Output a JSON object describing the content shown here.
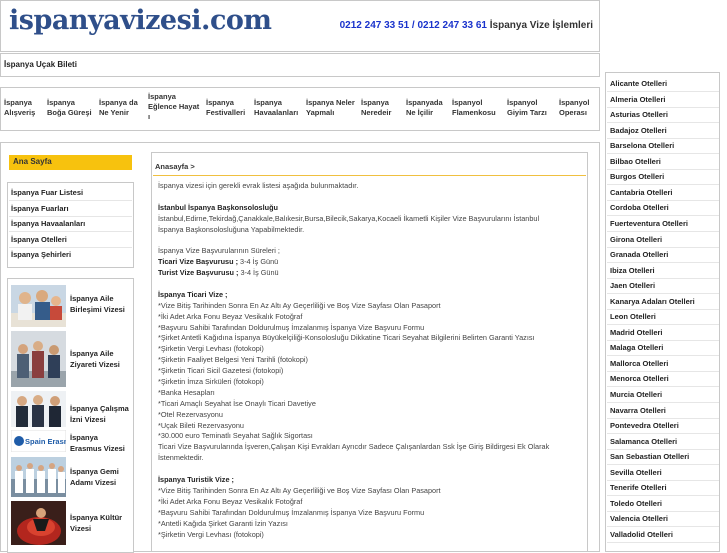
{
  "header": {
    "logo_text": "ispanyavizesi.com",
    "phone1": "0212 247 33 51",
    "phone_sep": " / ",
    "phone2": "0212 247 33 61",
    "tagline": " İspanya Vize İşlemleri"
  },
  "topbar": {
    "link": "İspanya Uçak Bileti"
  },
  "nav": [
    [
      "İspanya",
      "Alışveriş"
    ],
    [
      "İspanya",
      "Boğa Güreşi"
    ],
    [
      "İspanya da",
      "Ne Yenir"
    ],
    [
      "İspanya",
      "Eğlence Hayat",
      "ı"
    ],
    [
      "İspanya",
      "Festivalleri"
    ],
    [
      "İspanya",
      "Havaalanları"
    ],
    [
      "İspanya Neler",
      "Yapmalı"
    ],
    [
      "İspanya",
      "Neredeir"
    ],
    [
      "İspanyada",
      "Ne İçilir"
    ],
    [
      "İspanyol",
      "Flamenkosu"
    ],
    [
      "İspanyol",
      "Giyim Tarzı"
    ],
    [
      "İspanyol",
      "Operası"
    ]
  ],
  "cities": [
    "Alicante Otelleri",
    "Almeria Otelleri",
    "Asturias Otelleri",
    "Badajoz Otelleri",
    "Barselona Otelleri",
    "Bilbao Otelleri",
    "Burgos Otelleri",
    "Cantabria Otelleri",
    "Cordoba Otelleri",
    "Fuerteventura Otelleri",
    "Girona Otelleri",
    "Granada Otelleri",
    "Ibiza Otelleri",
    "Jaen Otelleri",
    "Kanarya Adaları Otelleri",
    "Leon Otelleri",
    "Madrid Otelleri",
    "Malaga Otelleri",
    "Mallorca Otelleri",
    "Menorca Otelleri",
    "Murcia Otelleri",
    "Navarra Otelleri",
    "Pontevedra Otelleri",
    "Salamanca Otelleri",
    "San Sebastian Otelleri",
    "Sevilla Otelleri",
    "Tenerife Otelleri",
    "Toledo Otelleri",
    "Valencia Otelleri",
    "Valladolid Otelleri"
  ],
  "sidebar": {
    "home_label": "Ana Sayfa",
    "menu": [
      "İspanya Fuar Listesi",
      "İspanya Fuarları",
      "İspanya Havaalanları",
      "İspanya Otelleri",
      "İspanya Şehirleri"
    ],
    "visas": [
      {
        "l1": "İspanya Aile",
        "l2": "Birleşimi Vizesi"
      },
      {
        "l1": "İspanya Aile",
        "l2": "Ziyareti Vizesi"
      },
      {
        "l1": "İspanya Çalışma",
        "l2": "İzni Vizesi"
      },
      {
        "l1": "İspanya",
        "l2": "Erasmus Vizesi"
      },
      {
        "l1": "İspanya Gemi",
        "l2": "Adamı Vizesi"
      },
      {
        "l1": "İspanya Kültür",
        "l2": "Vizesi"
      }
    ],
    "erasmus_logo_text": "Spain Erasmus"
  },
  "content": {
    "breadcrumb": "Anasayfa >",
    "intro": "İspanya vizesi için gerekli evrak listesi aşağıda bulunmaktadır.",
    "consulate_title": "İstanbul İspanya Başkonsolosluğu",
    "consulate_l1": "İstanbul,Edirne,Tekirdağ,Çanakkale,Balıkesir,Bursa,Bilecik,Sakarya,Kocaeli İkametli Kişiler Vize Başvurularını İstanbul",
    "consulate_l2": "İspanya Başkonsolosluğuna Yapabilmektedir.",
    "durations_title": "İspanya Vize Başvurularının Süreleri ;",
    "ticari_label": "Ticari Vize Başvurusu ;",
    "ticari_val": " 3-4 İş Günü",
    "turist_label": "Turist Vize Başvurusu ;",
    "turist_val": " 3-4 İş Günü",
    "ticari_title": "İspanya Ticari Vize ;",
    "ticari_items": [
      "*Vize Bitiş Tarihinden Sonra En Az Altı Ay Geçerliliği ve Boş Vize Sayfası Olan Pasaport",
      "*İki Adet Arka Fonu Beyaz Vesikalık Fotoğraf",
      "*Başvuru Sahibi Tarafından Doldurulmuş İmzalanmış İspanya Vize Başvuru Formu",
      "*Şirket Antetli Kağıdına İspanya Büyükelçiliği-Konsolosluğu Dikkatine Ticari Seyahat Bilgilerini Belirten Garanti Yazısı",
      "*Şirketin Vergi Levhası (fotokopi)",
      "*Şirketin Faaliyet Belgesi Yeni Tarihli (fotokopi)",
      "*Şirketin Ticari Sicil Gazetesi (fotokopi)",
      "*Şirketin İmza Sirküleri (fotokopi)",
      "*Banka Hesapları",
      "*Ticari Amaçlı Seyahat İse Onaylı Ticari Davetiye",
      "*Otel Rezervasyonu",
      "*Uçak Bileti Rezervasyonu",
      "*30.000 euro Teminatlı Seyahat Sağlık Sigortası",
      "Ticari Vize Başvurularında İşveren,Çalışan Kişi Evrakları Ayrıcdır Sadece Çalışanlardan Ssk İşe Giriş Bildirgesi Ek Olarak",
      "İstenmektedir."
    ],
    "turist_title": "İspanya Turistik Vize ;",
    "turist_items": [
      "*Vize Bitiş Tarihinden Sonra En Az Altı Ay Geçerliliği ve Boş Vize Sayfası Olan Pasaport",
      "*İki Adet Arka Fonu Beyaz Vesikalık Fotoğraf",
      "*Başvuru Sahibi Tarafından Doldurulmuş İmzalanmış İspanya Vize Başvuru Formu",
      "*Antetli Kağıda Şirket Garanti İzin Yazısı",
      "*Şirketin Vergi Levhası (fotokopi)"
    ]
  }
}
